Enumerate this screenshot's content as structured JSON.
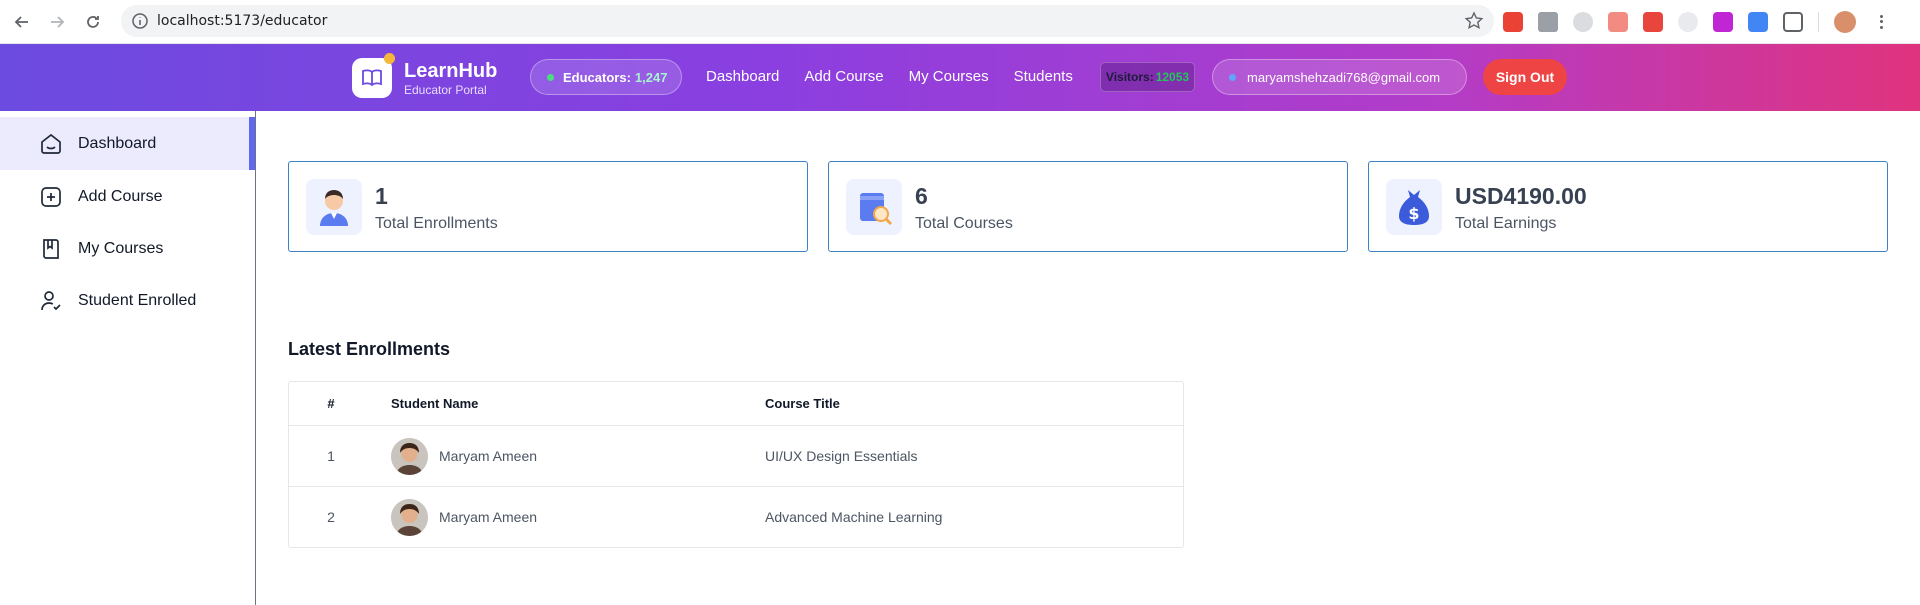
{
  "browser": {
    "url": "localhost:5173/educator"
  },
  "header": {
    "brand_name": "LearnHub",
    "brand_sub": "Educator Portal",
    "educators_label": "Educators:",
    "educators_count": "1,247",
    "nav": [
      "Dashboard",
      "Add Course",
      "My Courses",
      "Students"
    ],
    "visitors_label": "Visitors:",
    "visitors_count": "12053",
    "email": "maryamshehzadi768@gmail.com",
    "signout_label": "Sign Out"
  },
  "sidebar": {
    "items": [
      {
        "label": "Dashboard",
        "icon": "home-icon",
        "active": true
      },
      {
        "label": "Add Course",
        "icon": "add-icon",
        "active": false
      },
      {
        "label": "My Courses",
        "icon": "book-icon",
        "active": false
      },
      {
        "label": "Student Enrolled",
        "icon": "user-check-icon",
        "active": false
      }
    ]
  },
  "stats": [
    {
      "value": "1",
      "label": "Total Enrollments",
      "icon": "person-icon"
    },
    {
      "value": "6",
      "label": "Total Courses",
      "icon": "course-book-icon"
    },
    {
      "value": "USD4190.00",
      "label": "Total Earnings",
      "icon": "money-bag-icon"
    }
  ],
  "enrollments": {
    "title": "Latest Enrollments",
    "columns": [
      "#",
      "Student Name",
      "Course Title"
    ],
    "rows": [
      {
        "num": "1",
        "student": "Maryam Ameen",
        "course": "UI/UX Design Essentials"
      },
      {
        "num": "2",
        "student": "Maryam Ameen",
        "course": "Advanced Machine Learning"
      }
    ]
  },
  "colors": {
    "accent": "#6366f1",
    "card_border": "#3b82c4",
    "signout": "#ef4444"
  }
}
